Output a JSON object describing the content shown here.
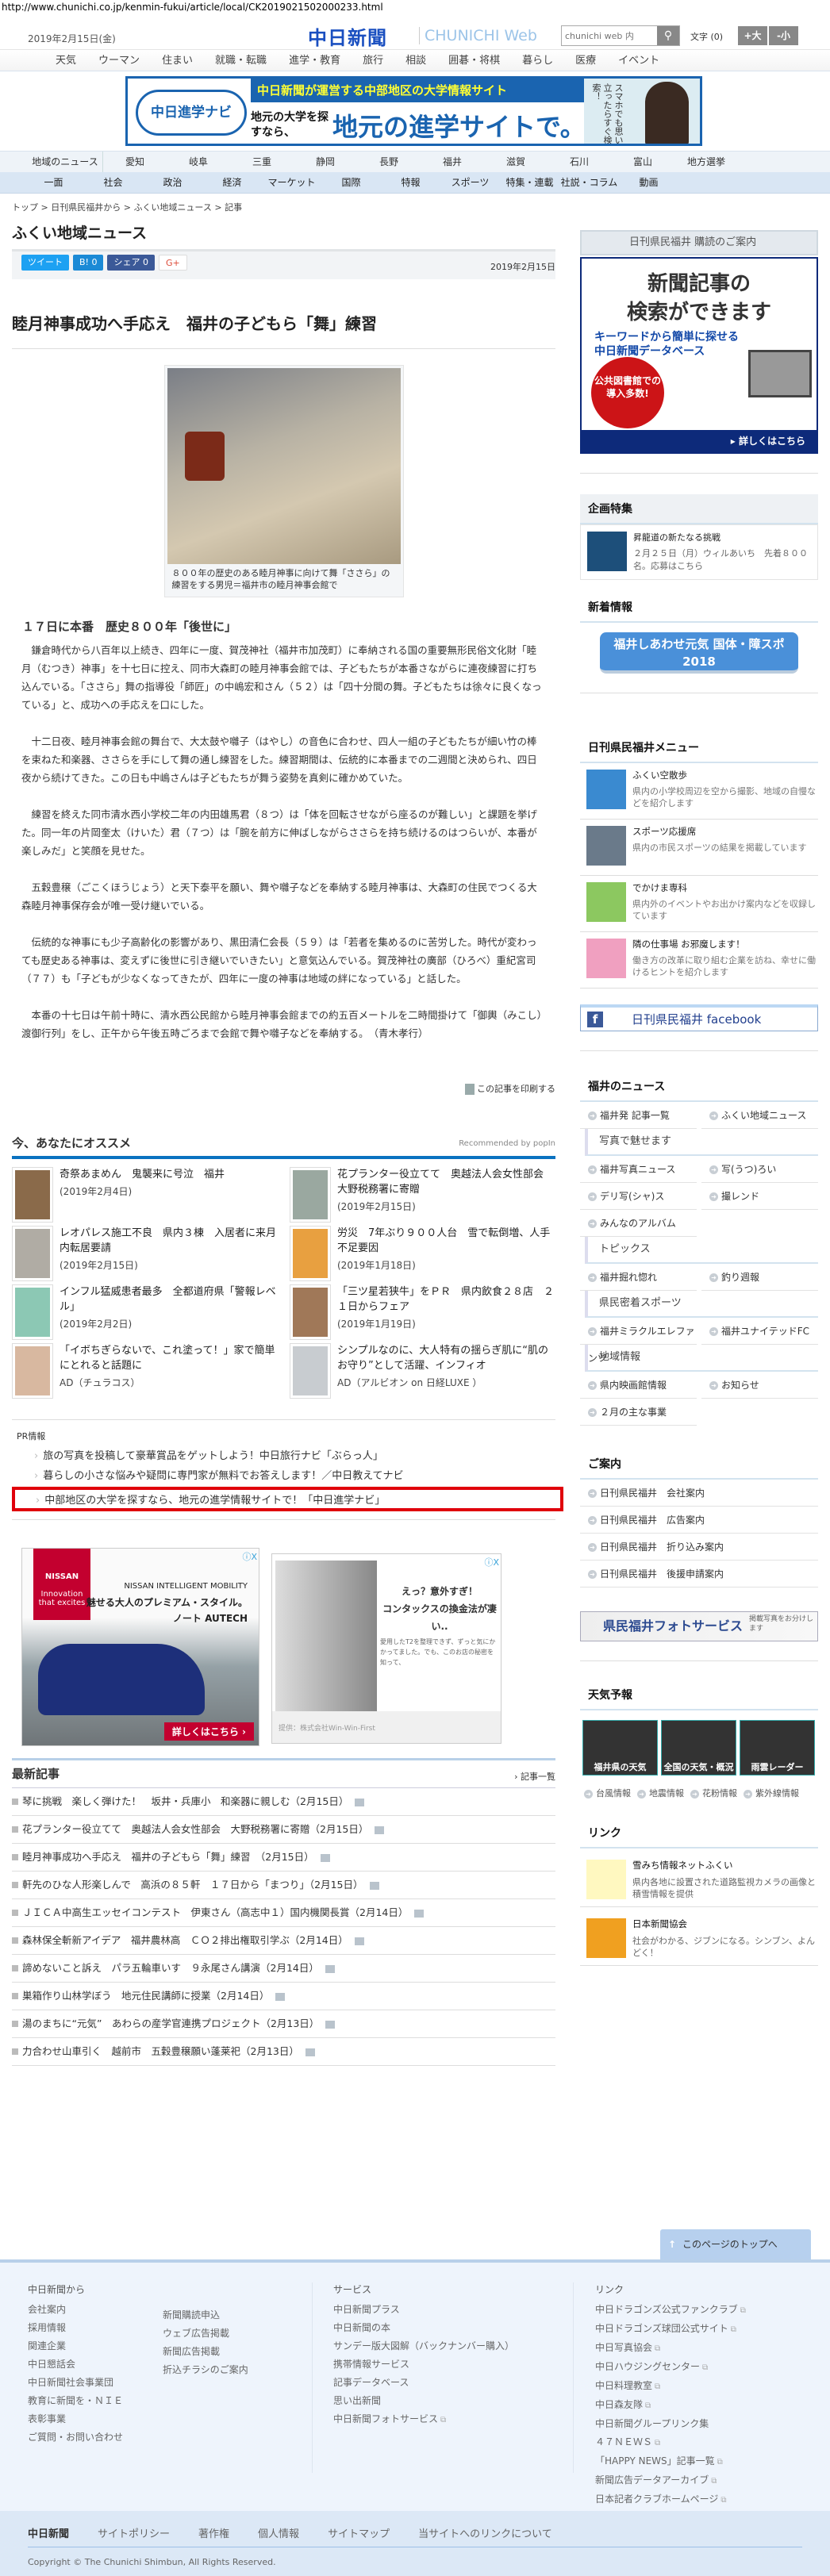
{
  "url": "http://www.chunichi.co.jp/kenmin-fukui/article/local/CK2019021502000233.html",
  "header": {
    "date": "2019年2月15日(金)",
    "logo": "中日新聞",
    "logo_sub": "CHUNICHI Web",
    "search_placeholder": "chunichi web 内",
    "search_icon": "magnifier",
    "font_size_label": "文字 (0)",
    "font_larger": "+大",
    "font_smaller": "-小"
  },
  "top_nav": [
    "天気",
    "ウーマン",
    "住まい",
    "就職・転職",
    "進学・教育",
    "旅行",
    "相談",
    "囲碁・将棋",
    "暮らし",
    "医療",
    "イベント"
  ],
  "banner": {
    "logo": "中日進学ナビ",
    "top": "中日新聞が運営する中部地区の大学情報サイト",
    "left": "地元の大学を探すなら、",
    "main": "地元の進学サイトで。",
    "side": "スマホでも思い立ったらすぐ検索！"
  },
  "region_nav": {
    "label": "地域のニュース",
    "items": [
      "愛知",
      "岐阜",
      "三重",
      "静岡",
      "長野",
      "福井",
      "滋賀",
      "石川",
      "富山",
      "地方選挙"
    ]
  },
  "cat_nav": [
    "一面",
    "社会",
    "政治",
    "経済",
    "マーケット",
    "国際",
    "特報",
    "スポーツ",
    "特集・連載",
    "社説・コラム",
    "動画"
  ],
  "breadcrumb": [
    "トップ",
    "日刊県民福井から",
    "ふくい地域ニュース",
    "記事"
  ],
  "section_title": "ふくい地域ニュース",
  "share": {
    "tweet": "ツイート",
    "hatena": "B! 0",
    "facebook": "シェア 0",
    "gplus": "G+",
    "date": "2019年2月15日"
  },
  "article": {
    "title": "睦月神事成功へ手応え　福井の子どもら「舞」練習",
    "caption": "８００年の歴史のある睦月神事に向けて舞「ささら」の練習をする男児＝福井市の睦月神事会館で",
    "subheading": "１７日に本番　歴史８００年「後世に」",
    "paragraphs": [
      "鎌倉時代から八百年以上続き、四年に一度、賀茂神社（福井市加茂町）に奉納される国の重要無形民俗文化財「睦月（むつき）神事」を十七日に控え、同市大森町の睦月神事会館では、子どもたちが本番さながらに連夜練習に打ち込んでいる。「ささら」舞の指導役「師匠」の中嶋宏和さん（５２）は「四十分間の舞。子どもたちは徐々に良くなっている」と、成功への手応えを口にした。",
      "十二日夜、睦月神事会館の舞台で、大太鼓や囃子（はやし）の音色に合わせ、四人一組の子どもたちが細い竹の棒を束ねた和楽器、ささらを手にして舞の通し練習をした。練習期間は、伝統的に本番までの二週間と決められ、四日夜から続けてきた。この日も中嶋さんは子どもたちが舞う姿勢を真剣に確かめていた。",
      "練習を終えた同市清水西小学校二年の内田雄馬君（８つ）は「体を回転させながら座るのが難しい」と課題を挙げた。同一年の片岡奎太（けいた）君（７つ）は「腕を前方に伸ばしながらささらを持ち続けるのはつらいが、本番が楽しみだ」と笑顔を見せた。",
      "五穀豊穣（ごこくほうじょう）と天下泰平を願い、舞や囃子などを奉納する睦月神事は、大森町の住民でつくる大森睦月神事保存会が唯一受け継いでいる。",
      "伝統的な神事にも少子高齢化の影響があり、黒田清仁会長（５９）は「若者を集めるのに苦労した。時代が変わっても歴史ある神事は、変えずに後世に引き継いでいきたい」と意気込んでいる。賀茂神社の廣部（ひろべ）重紀宮司（７７）も「子どもが少なくなってきたが、四年に一度の神事は地域の絆になっている」と話した。",
      "本番の十七日は午前十時に、清水西公民館から睦月神事会館までの約五百メートルを二時間掛けて「御輿（みこし）渡御行列」をし、正午から午後五時ごろまで会館で舞や囃子などを奉納する。　（青木孝行）"
    ],
    "print": "この記事を印刷する"
  },
  "recommend": {
    "title": "今、あなたにオススメ",
    "by": "Recommended by popIn",
    "items": [
      {
        "title": "奇祭あまめん　鬼襲来に号泣　福井",
        "date": "(2019年2月4日)",
        "color": "#8a6a4a"
      },
      {
        "title": "花プランター役立てて　奥越法人会女性部会　大野税務署に寄贈",
        "date": "(2019年2月15日)",
        "color": "#9aa8a0"
      },
      {
        "title": "レオパレス施工不良　県内３棟　入居者に来月内転居要請",
        "date": "(2019年2月15日)",
        "color": "#b0aca4"
      },
      {
        "title": "労災　7年ぶり９００人台　雪で転倒増、人手不足要因",
        "date": "(2019年1月18日)",
        "color": "#e8a040"
      },
      {
        "title": "インフル猛威患者最多　全都道府県「警報レベル」",
        "date": "(2019年2月2日)",
        "color": "#8cc8b4"
      },
      {
        "title": "「三ツ星若狭牛」をＰＲ　県内飲食２８店　２１日からフェア",
        "date": "(2019年1月19日)",
        "color": "#a07858"
      },
      {
        "title": "「イボちぎらないで、これ塗って！」家で簡単にとれると話題に",
        "date": "AD（チュラコス）",
        "color": "#d8b8a0"
      },
      {
        "title": "シンプルなのに、大人特有の揺らぎ肌に“肌のお守り”として活躍、インフィオ",
        "date": "AD（アルビオン on 日経LUXE ）",
        "color": "#c8ccd0"
      }
    ]
  },
  "pr": {
    "label": "PR情報",
    "items": [
      "旅の写真を投稿して豪華賞品をゲットしよう！中日旅行ナビ「ぶらっ人」",
      "暮らしの小さな悩みや疑問に専門家が無料でお答えします！／中日教えてナビ"
    ],
    "highlight": "中部地区の大学を探すなら、地元の進学情報サイトで！「中日進学ナビ」"
  },
  "ads": {
    "nissan": {
      "brand": "NISSAN",
      "tag": "Innovation that excites",
      "line1": "NISSAN INTELLIGENT MOBILITY",
      "line2": "魅せる大人のプレミアム・スタイル。",
      "line3": "ノート AUTECH",
      "cta": "詳しくはこちら ›"
    },
    "contax": {
      "h1": "えっ？意外すぎ！",
      "h2": "コンタックスの換金法が凄い..",
      "desc": "愛用したT2を整理できず、ずっと気にかかってました。でも、このお店の秘密を知って、",
      "source": "提供：株式会社Win-Win-First"
    },
    "close": "ⓘX"
  },
  "latest": {
    "title": "最新記事",
    "more": "› 記事一覧",
    "items": [
      "琴に挑戦　楽しく弾けた！　坂井・兵庫小　和楽器に親しむ（2月15日）",
      "花プランター役立てて　奥越法人会女性部会　大野税務署に寄贈（2月15日）",
      "睦月神事成功へ手応え　福井の子どもら「舞」練習　（2月15日）",
      "軒先のひな人形楽しんで　高浜の８５軒　１７日から「まつり」（2月15日）",
      "ＪＩＣＡ中高生エッセイコンテスト　伊東さん（高志中１）国内機関長賞（2月14日）",
      "森林保全斬新アイデア　福井農林高　ＣＯ２排出権取引学ぶ（2月14日）",
      "諦めないこと訴え　パラ五輪車いす　９永尾さん講演（2月14日）",
      "巣箱作り山林学ぼう　地元住民講師に授業（2月14日）",
      "湯のまちに“元気”　あわらの産学官連携プロジェクト（2月13日）",
      "力合わせ山車引く　越前市　五穀豊穣願い蓬莱祀（2月13日）"
    ]
  },
  "sidebar": {
    "subscribe": "日刊県民福井 購読のご案内",
    "db_ad": {
      "l1": "新聞記事の",
      "l2": "検索ができます",
      "l3": "キーワードから簡単に探せる",
      "l4": "中日新聞データベース",
      "badge": "公共図書館での導入多数!",
      "more": "▸ 詳しくはこちら"
    },
    "kikaku": {
      "title": "企画特集",
      "item_title": "昇龍道の新たなる挑戦",
      "item_desc": "２月２５日（月）ウィルあいち　先着８００名。応募はこちら"
    },
    "shinchaku": {
      "title": "新着情報",
      "banner": "福井しあわせ元気 国体・障スポ2018"
    },
    "menu": {
      "title": "日刊県民福井メニュー",
      "items": [
        {
          "title": "ふくい空散歩",
          "desc": "県内の小学校周辺を空から撮影、地域の自慢などを紹介します",
          "color": "#3a8ad0"
        },
        {
          "title": "スポーツ応援席",
          "desc": "県内の市民スポーツの結果を掲載しています",
          "color": "#6a7a8a"
        },
        {
          "title": "でかけま専科",
          "desc": "県内外のイベントやお出かけ案内などを収録しています",
          "color": "#8cc860"
        },
        {
          "title": "隣の仕事場 お邪魔します！",
          "desc": "働き方の改革に取り組む企業を訪ね、幸せに働けるヒントを紹介します",
          "color": "#f0a0c0"
        }
      ]
    },
    "facebook": "日刊県民福井 facebook",
    "fukui_news": {
      "title": "福井のニュース",
      "top": [
        "福井発 記事一覧",
        "ふくい地域ニュース"
      ],
      "groups": [
        {
          "label": "写真で魅せます",
          "items": [
            "福井写真ニュース",
            "写(うつ)ろい",
            "デリ写(シャ)ス",
            "撮レンド",
            "みんなのアルバム"
          ]
        },
        {
          "label": "トピックス",
          "items": [
            "福井掘れ惚れ",
            "釣り週報"
          ]
        },
        {
          "label": "県民密着スポーツ",
          "items": [
            "福井ミラクルエレファンツ",
            "福井ユナイテッドFC"
          ]
        },
        {
          "label": "地域情報",
          "items": [
            "県内映画館情報",
            "お知らせ",
            "２月の主な事業"
          ]
        }
      ]
    },
    "annai": {
      "title": "ご案内",
      "items": [
        "日刊県民福井　会社案内",
        "日刊県民福井　広告案内",
        "日刊県民福井　折り込み案内",
        "日刊県民福井　後援申請案内"
      ]
    },
    "photo_service": {
      "title": "県民福井フォトサービス",
      "sub": "掲載写真をお分けします"
    },
    "weather": {
      "title": "天気予報",
      "tiles": [
        "福井県の天気",
        "全国の天気・概況",
        "雨雲レーダー"
      ],
      "links": [
        "台風情報",
        "地震情報",
        "花粉情報",
        "紫外線情報"
      ]
    },
    "links": {
      "title": "リンク",
      "items": [
        {
          "title": "雪みち情報ネットふくい",
          "desc": "県内各地に設置された道路監視カメラの画像と積雪情報を提供",
          "color": "#fff8c0"
        },
        {
          "title": "日本新聞協会",
          "desc": "社会がわかる、ジブンになる。シンブン、よんどく！",
          "color": "#f0a020"
        }
      ]
    }
  },
  "page_top": "このページのトップへ",
  "footer": {
    "col1": {
      "title": "中日新聞から",
      "a": [
        "会社案内",
        "採用情報",
        "関連企業",
        "中日懇話会",
        "中日新聞社会事業団",
        "教育に新聞を・ＮＩＥ",
        "表彰事業",
        "ご質問・お問い合わせ"
      ],
      "b": [
        "新聞購読申込",
        "ウェブ広告掲載",
        "新聞広告掲載",
        "折込チラシのご案内"
      ]
    },
    "col2": {
      "title": "サービス",
      "items": [
        "中日新聞プラス",
        "中日新聞の本",
        "サンデー版大図解（バックナンバー購入）",
        "携帯情報サービス",
        "記事データベース",
        "思い出新聞",
        "中日新聞フォトサービス"
      ]
    },
    "col3": {
      "title": "リンク",
      "items": [
        "中日ドラゴンズ公式ファンクラブ",
        "中日ドラゴンズ球団公式サイト",
        "中日写真協会",
        "中日ハウジングセンター",
        "中日料理教室",
        "中日森友隊",
        "中日新聞グループリンク集",
        "４７ＮＥＷＳ",
        "「HAPPY NEWS」記事一覧",
        "新聞広告データアーカイブ",
        "日本記者クラブホームページ"
      ]
    },
    "bottom_logo": "中日新聞",
    "bottom_links": [
      "サイトポリシー",
      "著作権",
      "個人情報",
      "サイトマップ",
      "当サイトへのリンクについて"
    ],
    "copyright": "Copyright © The Chunichi Shimbun, All Rights Reserved."
  }
}
